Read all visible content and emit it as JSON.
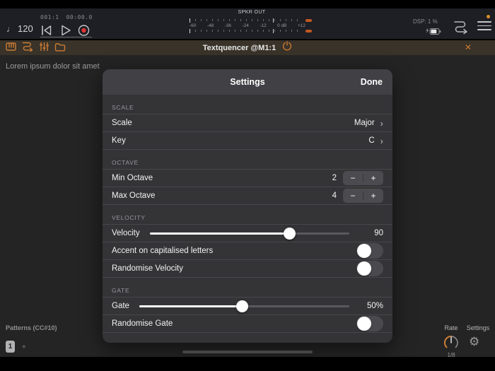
{
  "transport": {
    "tempo_note": "♩",
    "tempo_value": "120",
    "position_bar": "001:1",
    "position_time": "00:00.0",
    "meter": {
      "label": "SPKR OUT",
      "ticks": [
        "-60",
        "-48",
        "-36",
        "-24",
        "-12",
        "0 dB",
        "+12"
      ]
    },
    "dsp_label": "DSP: 1 %"
  },
  "plugin_bar": {
    "title": "Textquencer @M1:1",
    "close_glyph": "✕"
  },
  "canvas": {
    "text": "Lorem ipsum dolor sit amet",
    "patterns_label": "Patterns (CC#10)",
    "pattern_1": "1",
    "pattern_add": "+",
    "rate_label": "Rate",
    "rate_value": "1/8",
    "settings_label": "Settings",
    "gear_glyph": "⚙"
  },
  "modal": {
    "title": "Settings",
    "done_label": "Done",
    "chevron": "›",
    "stepper_minus": "−",
    "stepper_plus": "+",
    "sections": [
      {
        "header": "SCALE",
        "rows": [
          {
            "label": "Scale",
            "value": "Major"
          },
          {
            "label": "Key",
            "value": "C"
          }
        ]
      },
      {
        "header": "OCTAVE",
        "rows": [
          {
            "label": "Min Octave",
            "value": "2"
          },
          {
            "label": "Max Octave",
            "value": "4"
          }
        ]
      },
      {
        "header": "VELOCITY",
        "rows": [
          {
            "label": "Velocity",
            "value": "90",
            "fill_pct": 70
          },
          {
            "label": "Accent on capitalised letters",
            "toggle_on": false
          },
          {
            "label": "Randomise Velocity",
            "toggle_on": false
          }
        ]
      },
      {
        "header": "GATE",
        "rows": [
          {
            "label": "Gate",
            "value": "50%",
            "fill_pct": 49
          },
          {
            "label": "Randomise Gate",
            "toggle_on": false
          }
        ]
      }
    ]
  },
  "colors": {
    "accent_orange": "#cb7c33",
    "record_red": "#e03434",
    "modal_bg": "#343437",
    "modal_header_bg": "#404045",
    "toolbar_bg": "#39332a",
    "transport_bg": "#1d1f24"
  }
}
